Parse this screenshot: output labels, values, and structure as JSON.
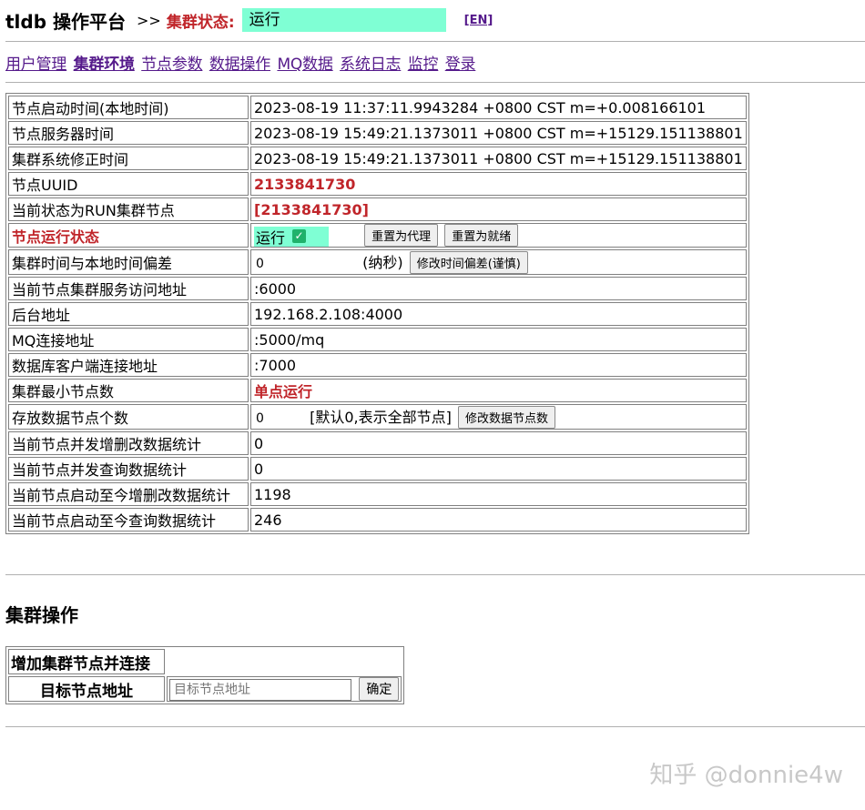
{
  "header": {
    "app_title": "tldb 操作平台",
    "separator": ">>",
    "status_label": "集群状态:",
    "status_value": "运行",
    "lang_link": "[EN]"
  },
  "nav": {
    "items": [
      {
        "label": "用户管理",
        "active": false
      },
      {
        "label": "集群环境",
        "active": true
      },
      {
        "label": "节点参数",
        "active": false
      },
      {
        "label": "数据操作",
        "active": false
      },
      {
        "label": "MQ数据",
        "active": false
      },
      {
        "label": "系统日志",
        "active": false
      },
      {
        "label": "监控",
        "active": false
      },
      {
        "label": "登录",
        "active": false
      }
    ]
  },
  "info": {
    "start_time_label": "节点启动时间(本地时间)",
    "start_time_value": "2023-08-19 11:37:11.9943284 +0800 CST m=+0.008166101",
    "server_time_label": "节点服务器时间",
    "server_time_value": "2023-08-19 15:49:21.1373011 +0800 CST m=+15129.151138801",
    "cluster_time_label": "集群系统修正时间",
    "cluster_time_value": "2023-08-19 15:49:21.1373011 +0800 CST m=+15129.151138801",
    "uuid_label": "节点UUID",
    "uuid_value": "2133841730",
    "run_node_label": "当前状态为RUN集群节点",
    "run_node_value": "[2133841730]",
    "run_state_label": "节点运行状态",
    "run_state_value": "运行",
    "reset_proxy_button": "重置为代理",
    "reset_ready_button": "重置为就绪",
    "time_offset_label": "集群时间与本地时间偏差",
    "time_offset_value": "0",
    "time_offset_unit": "(纳秒)",
    "modify_offset_button": "修改时间偏差(谨慎)",
    "service_addr_label": "当前节点集群服务访问地址",
    "service_addr_value": ":6000",
    "admin_addr_label": "后台地址",
    "admin_addr_value": "192.168.2.108:4000",
    "mq_addr_label": "MQ连接地址",
    "mq_addr_value": ":5000/mq",
    "db_client_addr_label": "数据库客户端连接地址",
    "db_client_addr_value": ":7000",
    "min_nodes_label": "集群最小节点数",
    "min_nodes_value": "单点运行",
    "data_nodes_label": "存放数据节点个数",
    "data_nodes_value": "0",
    "data_nodes_hint": "[默认0,表示全部节点]",
    "modify_data_nodes_button": "修改数据节点数",
    "concurrent_write_label": "当前节点并发增删改数据统计",
    "concurrent_write_value": "0",
    "concurrent_query_label": "当前节点并发查询数据统计",
    "concurrent_query_value": "0",
    "total_write_label": "当前节点启动至今增删改数据统计",
    "total_write_value": "1198",
    "total_query_label": "当前节点启动至今查询数据统计",
    "total_query_value": "246"
  },
  "cluster_ops": {
    "section_title": "集群操作",
    "table_header": "增加集群节点并连接",
    "target_label": "目标节点地址",
    "target_placeholder": "目标节点地址",
    "confirm_button": "确定"
  },
  "watermark": "知乎 @donnie4w",
  "colors": {
    "accent_red": "#c0252a",
    "status_bg": "#7fffd4",
    "link": "#551a8b",
    "check": "#1fb26b"
  }
}
